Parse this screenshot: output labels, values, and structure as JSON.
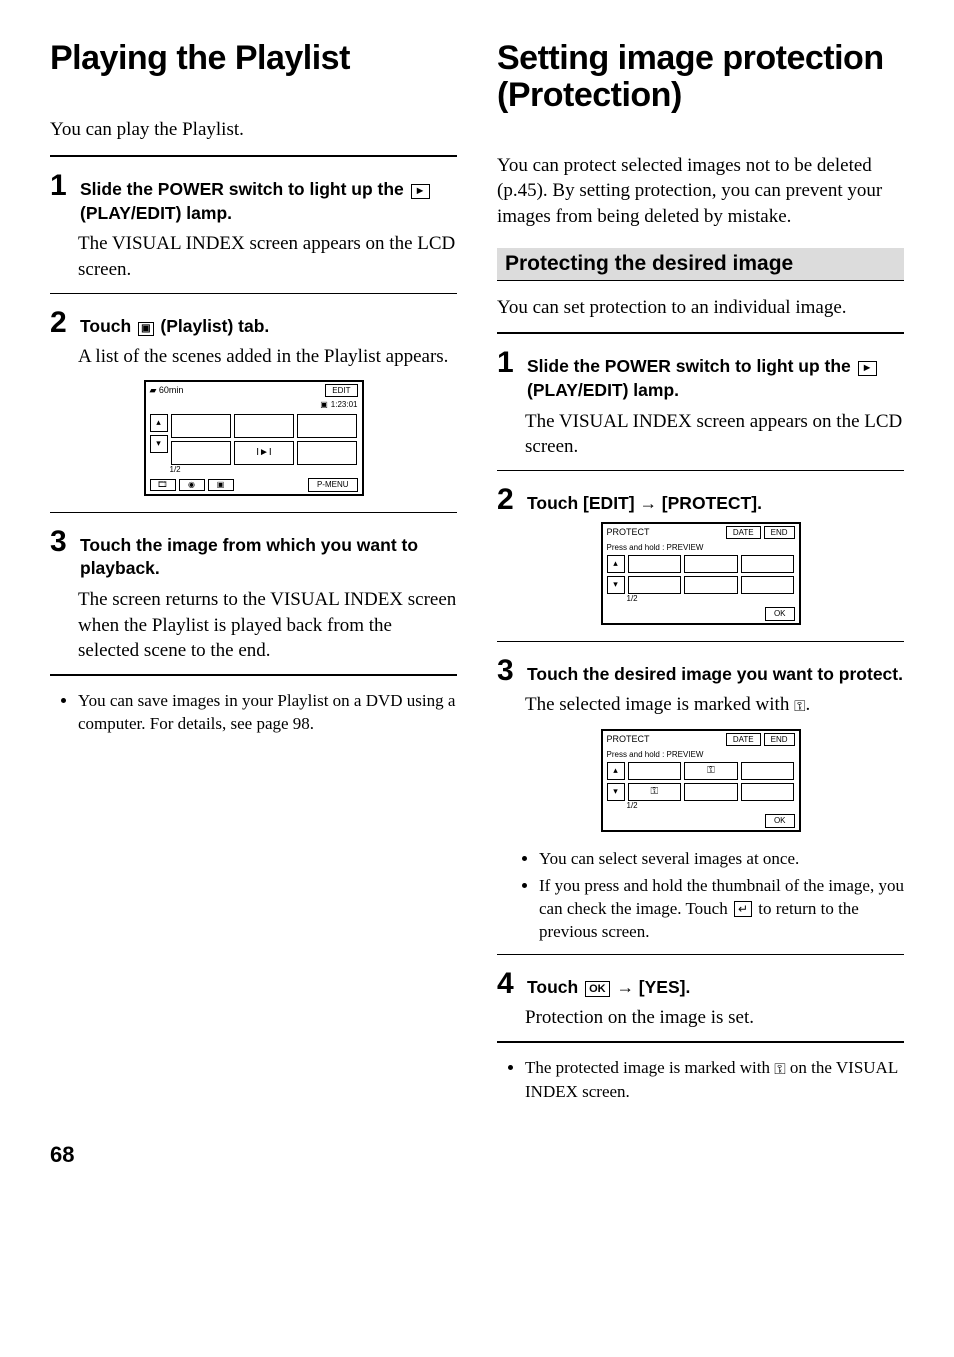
{
  "page_number": "68",
  "left": {
    "heading": "Playing the Playlist",
    "intro": "You can play the Playlist.",
    "steps": [
      {
        "num": "1",
        "title_pre": "Slide the POWER switch to light up the ",
        "title_post": " (PLAY/EDIT) lamp.",
        "body": "The VISUAL INDEX screen appears on the LCD screen."
      },
      {
        "num": "2",
        "title_pre": "Touch ",
        "title_post": " (Playlist) tab.",
        "body": "A list of the scenes added in the Playlist appears."
      },
      {
        "num": "3",
        "title": "Touch the image from which you want to playback.",
        "body": "The screen returns to the VISUAL INDEX screen when the Playlist is played back from the selected scene to the end."
      }
    ],
    "shot1": {
      "battery": "60min",
      "edit": "EDIT",
      "time": "1:23:01",
      "pager": "1/2",
      "menu": "P-MENU",
      "cell_mark": "I►I"
    },
    "note": "You can save images in your Playlist on a DVD using a computer. For details, see page 98."
  },
  "right": {
    "heading": "Setting image protection (Protection)",
    "intro": "You can protect selected images not to be deleted (p.45). By setting protection, you can prevent your images from being deleted by mistake.",
    "sub_heading": "Protecting the desired image",
    "sub_intro": "You can set protection to an individual image.",
    "steps": [
      {
        "num": "1",
        "title_pre": "Slide the POWER switch to light up the ",
        "title_post": " (PLAY/EDIT) lamp.",
        "body": "The VISUAL INDEX screen appears on the LCD screen."
      },
      {
        "num": "2",
        "title_pre": "Touch [EDIT] ",
        "title_post": " [PROTECT].",
        "arrow": "→"
      },
      {
        "num": "3",
        "title": "Touch the desired image you want to protect.",
        "body_pre": "The selected image is marked with ",
        "body_post": "."
      },
      {
        "num": "4",
        "title_pre": "Touch ",
        "title_mid": " ",
        "title_post": " [YES].",
        "arrow": "→",
        "ok": "OK",
        "body": "Protection on the image is set."
      }
    ],
    "shot_protect": {
      "title": "PROTECT",
      "date": "DATE",
      "end": "END",
      "msg": "Press and hold : PREVIEW",
      "pager": "1/2",
      "ok": "OK"
    },
    "notes_mid": [
      "You can select several images at once.",
      "If you press and hold the thumbnail of the image, you can check the image. Touch  to return to the previous screen."
    ],
    "note_end_pre": "The protected image is marked with ",
    "note_end_post": " on the VISUAL INDEX screen."
  }
}
